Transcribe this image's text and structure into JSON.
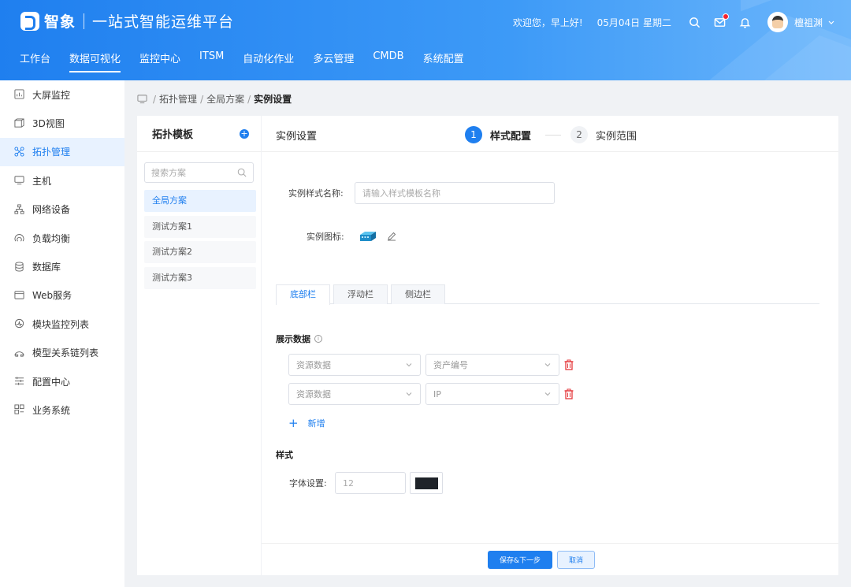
{
  "app": {
    "brand": "智象",
    "title": "一站式智能运维平台"
  },
  "header": {
    "greeting": "欢迎您，早上好!",
    "date": "05月04日 星期二",
    "username": "檀祖渊"
  },
  "topnav": [
    {
      "label": "工作台"
    },
    {
      "label": "数据可视化"
    },
    {
      "label": "监控中心"
    },
    {
      "label": "ITSM"
    },
    {
      "label": "自动化作业"
    },
    {
      "label": "多云管理"
    },
    {
      "label": "CMDB"
    },
    {
      "label": "系统配置"
    }
  ],
  "sidebar": {
    "items": [
      {
        "label": "大屏监控",
        "icon": "chart-icon"
      },
      {
        "label": "3D视图",
        "icon": "cube-icon"
      },
      {
        "label": "拓扑管理",
        "icon": "topology-icon"
      },
      {
        "label": "主机",
        "icon": "monitor-icon"
      },
      {
        "label": "网络设备",
        "icon": "network-icon"
      },
      {
        "label": "负载均衡",
        "icon": "balance-icon"
      },
      {
        "label": "数据库",
        "icon": "database-icon"
      },
      {
        "label": "Web服务",
        "icon": "browser-icon"
      },
      {
        "label": "模块监控列表",
        "icon": "gauge-icon"
      },
      {
        "label": "模型关系链列表",
        "icon": "relation-icon"
      },
      {
        "label": "配置中心",
        "icon": "sliders-icon"
      },
      {
        "label": "业务系统",
        "icon": "grid-icon"
      }
    ]
  },
  "breadcrumb": {
    "items": [
      "拓扑管理",
      "全局方案"
    ],
    "current": "实例设置"
  },
  "left_panel": {
    "title": "拓扑模板",
    "search_placeholder": "搜索方案",
    "items": [
      "全局方案",
      "测试方案1",
      "测试方案2",
      "测试方案3"
    ]
  },
  "main": {
    "title": "实例设置",
    "steps": [
      {
        "num": "1",
        "label": "样式配置"
      },
      {
        "num": "2",
        "label": "实例范围"
      }
    ],
    "name_label": "实例样式名称:",
    "name_placeholder": "请输入样式模板名称",
    "icon_label": "实例图标:",
    "tabs": [
      "底部栏",
      "浮动栏",
      "侧边栏"
    ],
    "display_title": "展示数据",
    "rows": [
      {
        "source": "资源数据",
        "field": "资产编号"
      },
      {
        "source": "资源数据",
        "field": "IP"
      }
    ],
    "add_label": "新增",
    "style_title": "样式",
    "font_label": "字体设置:",
    "font_size": "12",
    "font_color": "#1f2329",
    "save_label": "保存&下一步",
    "cancel_label": "取消"
  },
  "colors": {
    "primary": "#1f7fef",
    "danger": "#e5393c"
  }
}
